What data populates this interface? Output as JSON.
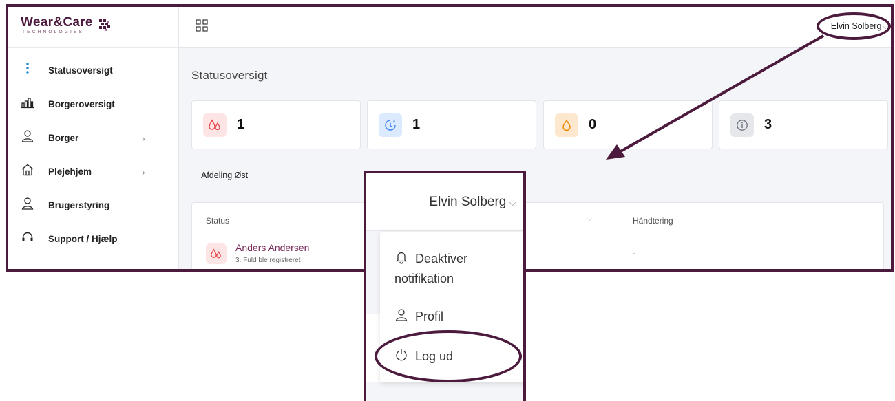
{
  "logo": {
    "brand": "Wear&Care",
    "tagline": "TECHNOLOGIES"
  },
  "sidebar": {
    "items": [
      {
        "label": "Statusoversigt",
        "icon": "vertical-dots-icon",
        "has_children": false
      },
      {
        "label": "Borgeroversigt",
        "icon": "bar-chart-icon",
        "has_children": false
      },
      {
        "label": "Borger",
        "icon": "user-icon",
        "has_children": true
      },
      {
        "label": "Plejehjem",
        "icon": "home-icon",
        "has_children": true
      },
      {
        "label": "Brugerstyring",
        "icon": "user-icon",
        "has_children": false
      },
      {
        "label": "Support / Hjælp",
        "icon": "headset-icon",
        "has_children": false
      }
    ]
  },
  "topbar": {
    "user_name": "Elvin Solberg"
  },
  "main": {
    "page_title": "Statusoversigt",
    "stats": [
      {
        "value": "1",
        "icon": "drops-icon",
        "color": "#e5484d",
        "bg": "#fde4e5"
      },
      {
        "value": "1",
        "icon": "clock-alert-icon",
        "color": "#3b82f6",
        "bg": "#dbeafe"
      },
      {
        "value": "0",
        "icon": "drop-icon",
        "color": "#f08c00",
        "bg": "#fde8cf"
      },
      {
        "value": "3",
        "icon": "info-icon",
        "color": "#6b7280",
        "bg": "#e5e7eb"
      }
    ],
    "department": "Afdeling Øst",
    "table": {
      "headers": {
        "status": "Status",
        "handling": "Håndtering"
      },
      "rows": [
        {
          "name": "Anders Andersen",
          "detail": "3. Fuld ble registreret",
          "handling": "-"
        }
      ]
    }
  },
  "zoom": {
    "user_name": "Elvin Solberg",
    "menu": {
      "deactivate_line1": "Deaktiver",
      "deactivate_line2": "notifikation",
      "profile": "Profil",
      "logout": "Log ud"
    }
  },
  "colors": {
    "frame": "#4b1a3d",
    "accent_dots": "#2b8fd6"
  }
}
